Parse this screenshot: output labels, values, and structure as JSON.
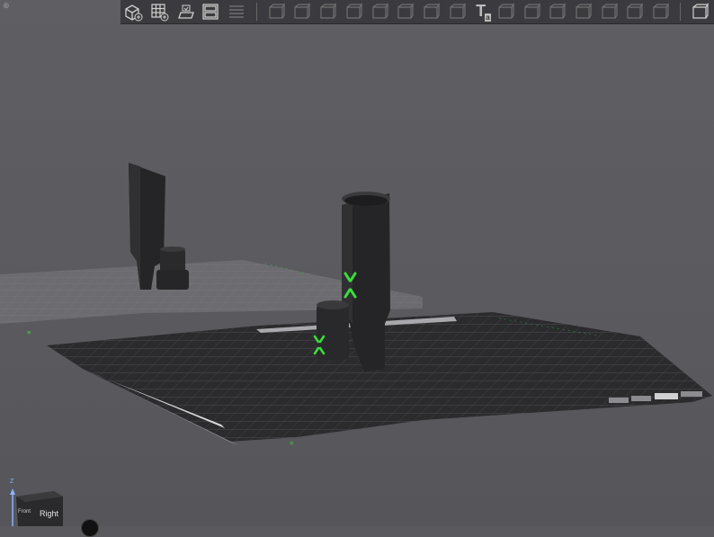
{
  "toolbar": {
    "buttons": [
      {
        "name": "add-cube-icon",
        "enabled": true
      },
      {
        "name": "add-grid-icon",
        "enabled": true
      },
      {
        "name": "import-model-icon",
        "enabled": true
      },
      {
        "name": "layout-icon",
        "enabled": true
      },
      {
        "name": "list-icon",
        "enabled": false
      },
      {
        "name": "move-icon",
        "enabled": false
      },
      {
        "name": "rotate-icon",
        "enabled": false
      },
      {
        "name": "scale-icon",
        "enabled": false
      },
      {
        "name": "cut-icon",
        "enabled": false
      },
      {
        "name": "split-icon",
        "enabled": false
      },
      {
        "name": "arrange-icon",
        "enabled": false
      },
      {
        "name": "support-icon",
        "enabled": false
      },
      {
        "name": "seam-icon",
        "enabled": false
      },
      {
        "name": "text-icon",
        "enabled": true,
        "glyph": "T",
        "sub": "a"
      },
      {
        "name": "boolean-icon",
        "enabled": false
      },
      {
        "name": "assembly-icon",
        "enabled": false
      },
      {
        "name": "box-icon",
        "enabled": false
      },
      {
        "name": "variable-layer-icon",
        "enabled": false
      },
      {
        "name": "brim-icon",
        "enabled": false
      },
      {
        "name": "measure-icon",
        "enabled": false
      },
      {
        "name": "edit-icon",
        "enabled": false
      },
      {
        "name": "export-icon",
        "enabled": true
      }
    ]
  },
  "viewcube": {
    "face_right": "Right",
    "face_front": "Front",
    "axis_z": "Z"
  },
  "colors": {
    "background": "#5b5b5f",
    "plate": "#2a2a2d",
    "grid": "#4a4a4e",
    "model": "#262628",
    "selection_handle": "#38e03a"
  }
}
